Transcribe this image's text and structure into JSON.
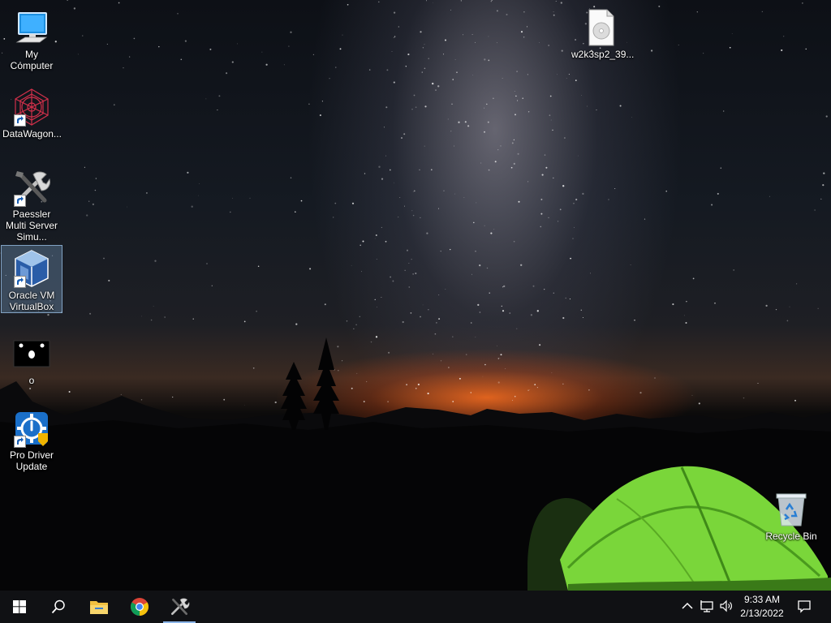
{
  "desktop": {
    "icons": [
      {
        "label": "My Computer",
        "icon": "monitor-icon"
      },
      {
        "label": "DataWagon...",
        "icon": "geometric-logo-icon"
      },
      {
        "label": "Paessler Multi Server Simu...",
        "icon": "tools-icon"
      },
      {
        "label": "Oracle VM VirtualBox",
        "icon": "virtualbox-icon"
      },
      {
        "label": "o",
        "icon": "black-image-icon"
      },
      {
        "label": "Pro Driver Update",
        "icon": "driver-update-icon"
      },
      {
        "label": "w2k3sp2_39...",
        "icon": "disc-image-file-icon"
      },
      {
        "label": "Recycle Bin",
        "icon": "recycle-bin-icon"
      }
    ],
    "selected_icon": "Oracle VM VirtualBox"
  },
  "taskbar": {
    "buttons": [
      {
        "name": "start",
        "icon": "windows-logo-icon"
      },
      {
        "name": "search",
        "icon": "search-icon"
      },
      {
        "name": "file-explorer",
        "icon": "folder-icon"
      },
      {
        "name": "chrome",
        "icon": "chrome-icon"
      },
      {
        "name": "paessler-app",
        "icon": "tools-icon",
        "active": true
      }
    ],
    "tray": {
      "icons": [
        "chevron-up-icon",
        "network-icon",
        "speaker-icon"
      ],
      "time": "9:33 AM",
      "date": "2/13/2022",
      "notification_icon": "notification-icon"
    },
    "accent_color": "#8ab4e8"
  }
}
